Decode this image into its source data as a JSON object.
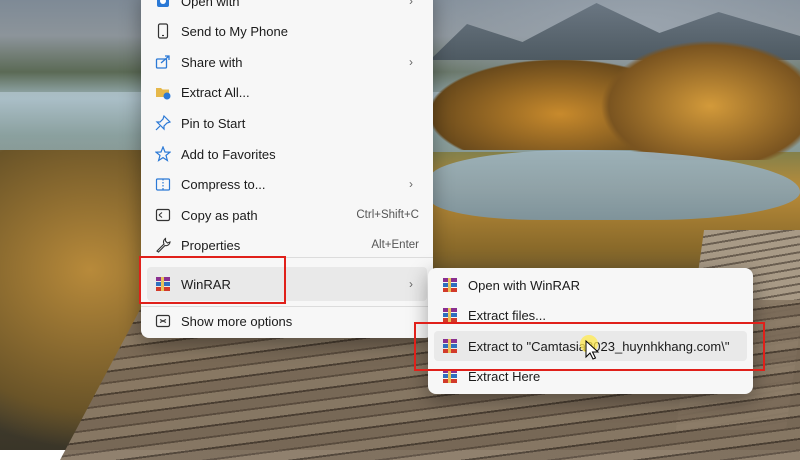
{
  "main_menu": {
    "items": [
      {
        "label": "Open with",
        "icon": "open-with-icon",
        "shortcut": "",
        "has_submenu": true
      },
      {
        "label": "Send to My Phone",
        "icon": "phone-icon",
        "shortcut": "",
        "has_submenu": false
      },
      {
        "label": "Share with",
        "icon": "share-icon",
        "shortcut": "",
        "has_submenu": true
      },
      {
        "label": "Extract All...",
        "icon": "extract-all-icon",
        "shortcut": "",
        "has_submenu": false
      },
      {
        "label": "Pin to Start",
        "icon": "pin-icon",
        "shortcut": "",
        "has_submenu": false
      },
      {
        "label": "Add to Favorites",
        "icon": "star-icon",
        "shortcut": "",
        "has_submenu": false
      },
      {
        "label": "Compress to...",
        "icon": "compress-icon",
        "shortcut": "",
        "has_submenu": true
      },
      {
        "label": "Copy as path",
        "icon": "copy-path-icon",
        "shortcut": "Ctrl+Shift+C",
        "has_submenu": false
      },
      {
        "label": "Properties",
        "icon": "wrench-icon",
        "shortcut": "Alt+Enter",
        "has_submenu": false
      },
      {
        "label": "WinRAR",
        "icon": "winrar-icon",
        "shortcut": "",
        "has_submenu": true
      },
      {
        "label": "Show more options",
        "icon": "more-options-icon",
        "shortcut": "",
        "has_submenu": false
      }
    ]
  },
  "sub_menu": {
    "items": [
      {
        "label": "Open with WinRAR",
        "icon": "winrar-icon"
      },
      {
        "label": "Extract files...",
        "icon": "winrar-icon"
      },
      {
        "label": "Extract to \"Camtasia2023_huynhkhang.com\\\"",
        "icon": "winrar-icon"
      },
      {
        "label": "Extract Here",
        "icon": "winrar-icon"
      }
    ]
  },
  "colors": {
    "highlight_box": "#e0201a",
    "menu_bg": "#f7f7f7",
    "accent_icon": "#1a6fd0"
  },
  "submenu_arrow": "›"
}
